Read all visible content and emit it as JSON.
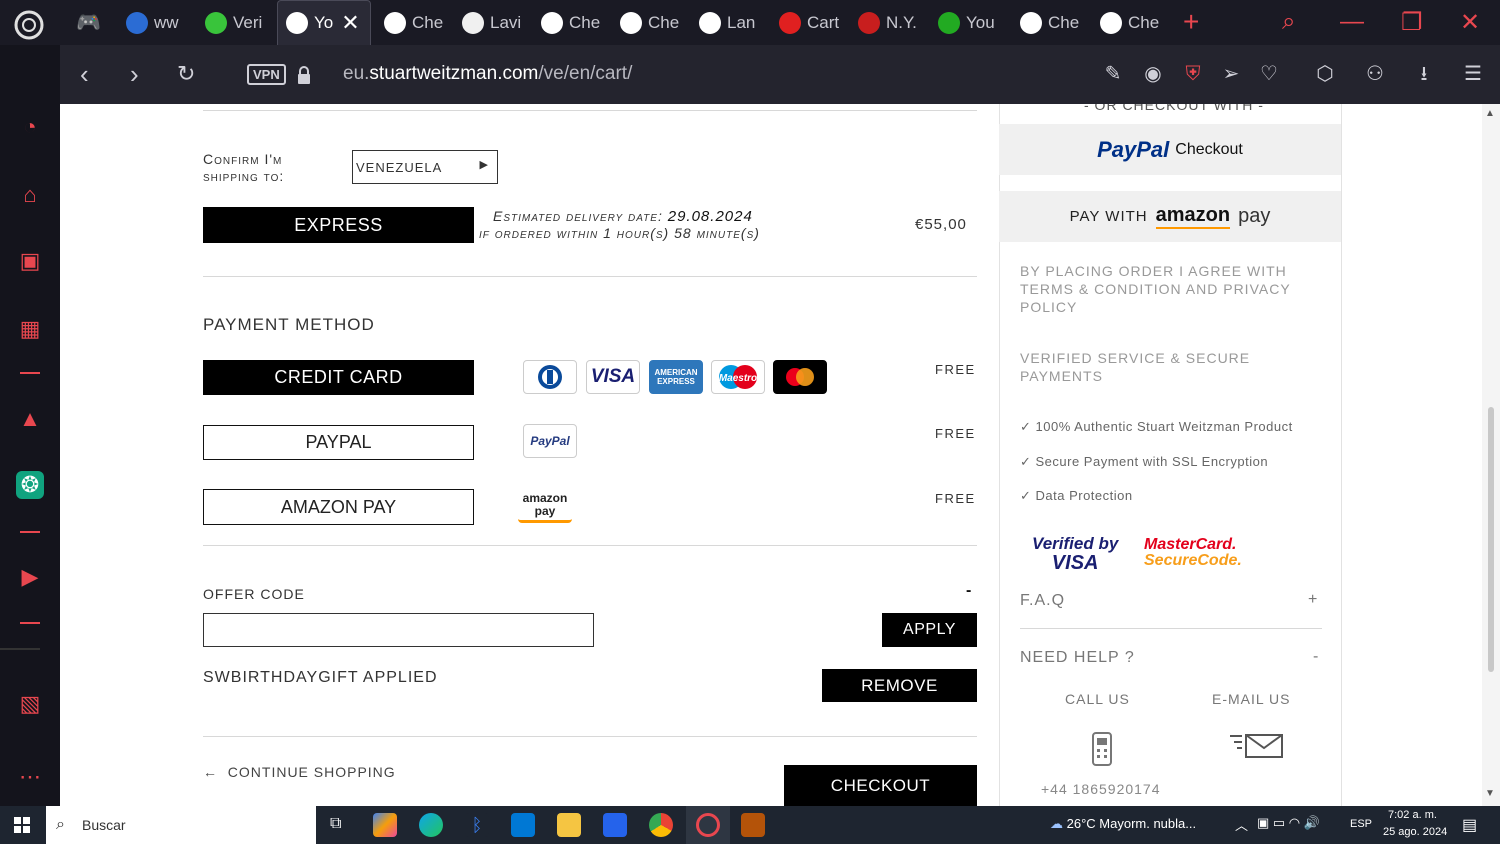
{
  "tabs": [
    {
      "label": "ww",
      "color": "#2b6cd4"
    },
    {
      "label": "Veri",
      "color": "#39c43b"
    },
    {
      "label": "Yo",
      "color": "#ffffff",
      "active": true
    },
    {
      "label": "Che",
      "color": "#ffffff"
    },
    {
      "label": "Lavi",
      "color": "#f0f0f0"
    },
    {
      "label": "Che",
      "color": "#ffffff"
    },
    {
      "label": "Che",
      "color": "#ffffff"
    },
    {
      "label": "Lan",
      "color": "#ffffff"
    },
    {
      "label": "Cart",
      "color": "#e02020"
    },
    {
      "label": "N.Y.",
      "color": "#c81e1e"
    },
    {
      "label": "You",
      "color": "#22aa22"
    },
    {
      "label": "Che",
      "color": "#ffffff"
    },
    {
      "label": "Che",
      "color": "#ffffff"
    }
  ],
  "address": {
    "vpn": "VPN",
    "url_prefix": "eu.",
    "url_host": "stuartweitzman.com",
    "url_path": "/ve/en/cart/"
  },
  "shipping": {
    "confirm_label": "Confirm I'm shipping to:",
    "country": "VENEZUELA",
    "method": "EXPRESS",
    "est_label": "Estimated delivery date:",
    "est_date": "29.08.2024",
    "if_ordered": "if ordered within 1 hour(s) 58 minute(s)",
    "price": "€55,00"
  },
  "payment": {
    "heading": "PAYMENT METHOD",
    "options": [
      {
        "label": "CREDIT CARD",
        "cost": "FREE"
      },
      {
        "label": "PAYPAL",
        "cost": "FREE"
      },
      {
        "label": "AMAZON PAY",
        "cost": "FREE"
      }
    ],
    "cards": [
      "Diners",
      "VISA",
      "AMERICAN EXPRESS",
      "Maestro",
      "mastercard"
    ],
    "paypal_badge": "PayPal",
    "amazon_badge": "amazon pay"
  },
  "offer": {
    "label": "OFFER CODE",
    "dash": "-",
    "apply": "APPLY",
    "applied": "SWBIRTHDAYGIFT APPLIED",
    "remove": "REMOVE"
  },
  "footer": {
    "continue": "CONTINUE SHOPPING",
    "checkout": "CHECKOUT"
  },
  "right": {
    "or_checkout": "- OR CHECKOUT WITH -",
    "paypal_brand": "PayPal",
    "paypal_checkout": "Checkout",
    "amazon_pay_with": "PAY WITH",
    "amazon_brand": "amazon",
    "amazon_pay": "pay",
    "terms": "BY PLACING ORDER I AGREE WITH TERMS & CONDITION AND PRIVACY POLICY",
    "verified": "VERIFIED SERVICE & SECURE PAYMENTS",
    "checks": [
      "✓ 100% Authentic Stuart Weitzman Product",
      "✓ Secure Payment with SSL Encryption",
      "✓ Data Protection"
    ],
    "verified_visa_1": "Verified by",
    "verified_visa_2": "VISA",
    "mc_secure_1": "MasterCard.",
    "mc_secure_2": "SecureCode.",
    "faq": "F.A.Q",
    "faq_toggle": "+",
    "help": "NEED HELP ?",
    "help_toggle": "-",
    "call": "CALL US",
    "email": "E-MAIL US",
    "phone": "+44 1865920174"
  },
  "taskbar": {
    "search": "Buscar",
    "weather": "26°C  Mayorm. nubla...",
    "lang": "ESP",
    "time": "7:02 a. m.",
    "date": "25 ago. 2024"
  }
}
